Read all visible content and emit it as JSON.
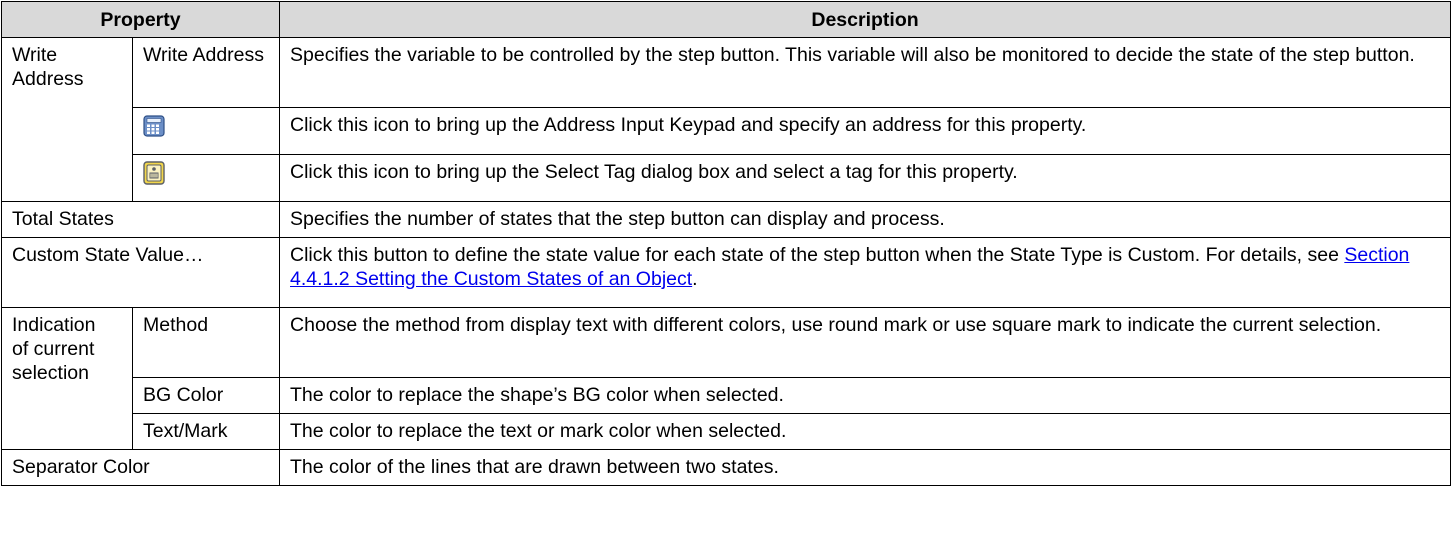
{
  "header": {
    "property": "Property",
    "description": "Description"
  },
  "rows": {
    "write_address": {
      "group": "Write Address",
      "sub": "Write Address",
      "desc": "Specifies the variable to be controlled by the step button. This variable will also be monitored to decide the state of the step button."
    },
    "keypad": {
      "icon": "calculator-keypad-icon",
      "desc": "Click this icon to bring up the Address Input Keypad and specify an address for this property."
    },
    "select_tag": {
      "icon": "tag-icon",
      "desc": "Click this icon to bring up the Select Tag dialog box and select a tag for this property."
    },
    "total_states": {
      "label": "Total States",
      "desc": "Specifies the number of states that the step button can display and process."
    },
    "custom_state": {
      "label": "Custom State Value…",
      "desc_prefix": "Click this button to define the state value for each state of the step button when the State Type is Custom. For details, see ",
      "link": "Section 4.4.1.2 Setting the Custom States of an Object",
      "desc_suffix": "."
    },
    "indication": {
      "group": "Indication of current selection",
      "method": {
        "sub": "Method",
        "desc": "Choose the method from display text with different colors, use round mark or use square mark to indicate the current selection."
      },
      "bg_color": {
        "sub": "BG Color",
        "desc": "The color to replace the shape’s BG color when selected."
      },
      "text_mark": {
        "sub": "Text/Mark",
        "desc": "The color to replace the text or mark color when selected."
      }
    },
    "separator": {
      "label": "Separator Color",
      "desc": "The color of the lines that are drawn between two states."
    }
  },
  "colors": {
    "header_bg": "#d9d9d9",
    "link": "#0000ee",
    "border": "#000000"
  }
}
